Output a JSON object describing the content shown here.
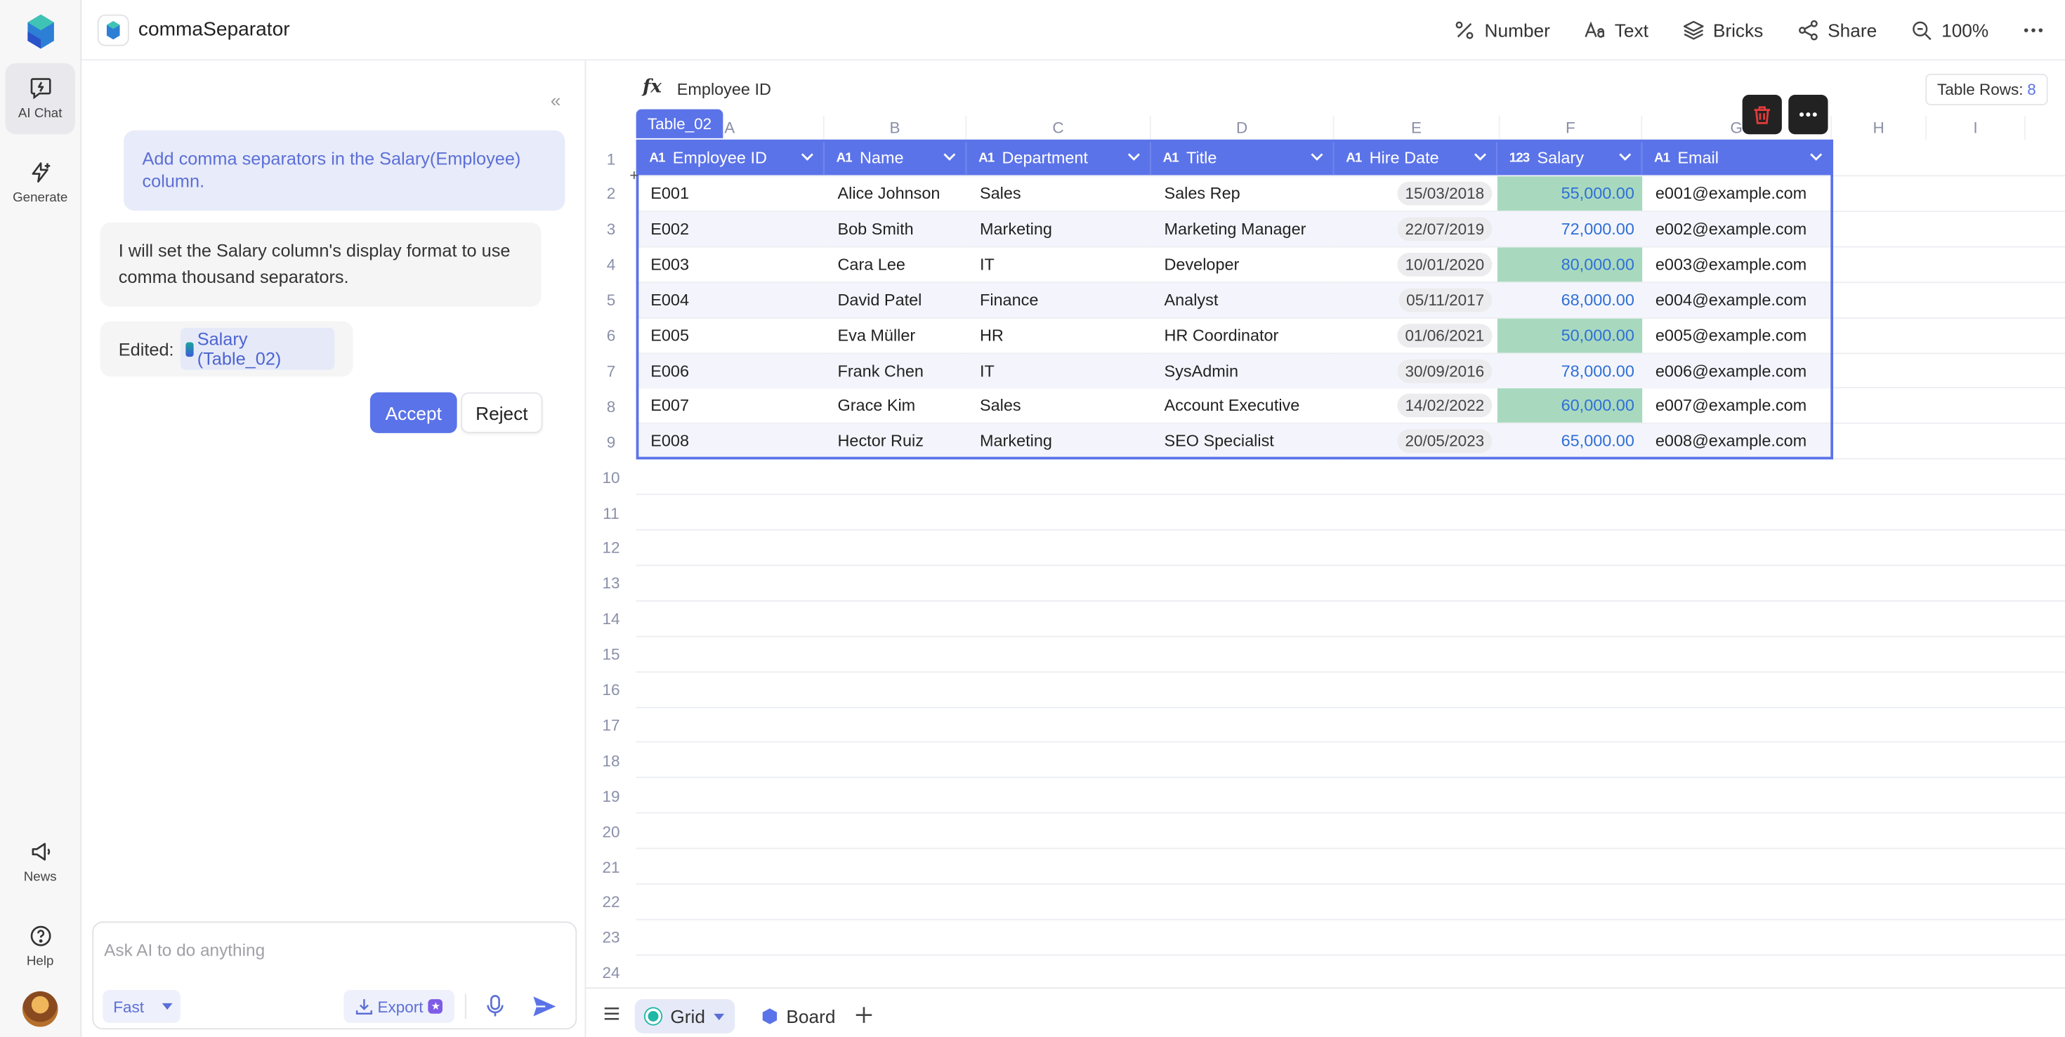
{
  "app": {
    "title": "commaSeparator"
  },
  "rail": {
    "items": [
      {
        "label": "AI Chat",
        "icon": "ai-chat-icon"
      },
      {
        "label": "Generate",
        "icon": "generate-icon"
      },
      {
        "label": "News",
        "icon": "megaphone-icon"
      },
      {
        "label": "Help",
        "icon": "help-icon"
      }
    ]
  },
  "toolbar": {
    "number_label": "Number",
    "text_label": "Text",
    "bricks_label": "Bricks",
    "share_label": "Share",
    "zoom_label": "100%"
  },
  "chat": {
    "user_message": "Add comma separators in the Salary(Employee) column.",
    "ai_message": "I will set the Salary column's display format to use comma thousand separators.",
    "edited_label": "Edited:",
    "edited_chip": "Salary (Table_02)",
    "accept_label": "Accept",
    "reject_label": "Reject",
    "input_placeholder": "Ask AI to do anything",
    "mode_label": "Fast",
    "export_label": "Export"
  },
  "formula": {
    "fx": "fx",
    "value": "Employee ID"
  },
  "table_rows": {
    "label": "Table Rows:",
    "count": "8"
  },
  "table": {
    "name": "Table_02",
    "column_letters": [
      "A",
      "B",
      "C",
      "D",
      "E",
      "F",
      "G",
      "H",
      "I"
    ],
    "row_numbers": [
      "1",
      "2",
      "3",
      "4",
      "5",
      "6",
      "7",
      "8",
      "9",
      "10",
      "11",
      "12",
      "13",
      "14",
      "15",
      "16",
      "17",
      "18",
      "19",
      "20",
      "21",
      "22",
      "23",
      "24"
    ],
    "headers": [
      {
        "type": "A1",
        "label": "Employee ID"
      },
      {
        "type": "A1",
        "label": "Name"
      },
      {
        "type": "A1",
        "label": "Department"
      },
      {
        "type": "A1",
        "label": "Title"
      },
      {
        "type": "A1",
        "label": "Hire Date"
      },
      {
        "type": "123",
        "label": "Salary"
      },
      {
        "type": "A1",
        "label": "Email"
      }
    ],
    "rows": [
      [
        "E001",
        "Alice Johnson",
        "Sales",
        "Sales Rep",
        "15/03/2018",
        "55,000.00",
        "e001@example.com"
      ],
      [
        "E002",
        "Bob Smith",
        "Marketing",
        "Marketing Manager",
        "22/07/2019",
        "72,000.00",
        "e002@example.com"
      ],
      [
        "E003",
        "Cara Lee",
        "IT",
        "Developer",
        "10/01/2020",
        "80,000.00",
        "e003@example.com"
      ],
      [
        "E004",
        "David Patel",
        "Finance",
        "Analyst",
        "05/11/2017",
        "68,000.00",
        "e004@example.com"
      ],
      [
        "E005",
        "Eva Müller",
        "HR",
        "HR Coordinator",
        "01/06/2021",
        "50,000.00",
        "e005@example.com"
      ],
      [
        "E006",
        "Frank Chen",
        "IT",
        "SysAdmin",
        "30/09/2016",
        "78,000.00",
        "e006@example.com"
      ],
      [
        "E007",
        "Grace Kim",
        "Sales",
        "Account Executive",
        "14/02/2022",
        "60,000.00",
        "e007@example.com"
      ],
      [
        "E008",
        "Hector Ruiz",
        "Marketing",
        "SEO Specialist",
        "20/05/2023",
        "65,000.00",
        "e008@example.com"
      ]
    ]
  },
  "views": [
    {
      "label": "Grid",
      "active": true
    },
    {
      "label": "Board",
      "active": false
    }
  ],
  "colors": {
    "accent": "#5b73e8",
    "salary_fill": "#a8d9bf",
    "salary_text": "#2f6fd6",
    "delete": "#e03b3b"
  }
}
